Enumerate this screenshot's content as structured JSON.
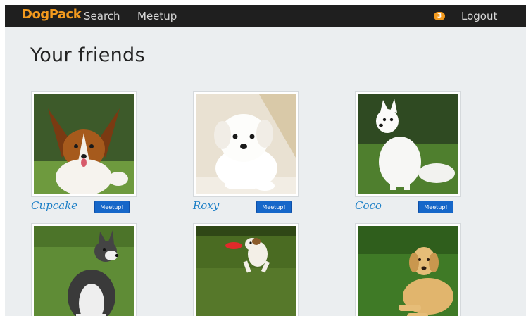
{
  "nav": {
    "brand": "DogPack",
    "search_label": "Search",
    "meetup_label": "Meetup",
    "notification_count": "3",
    "logout_label": "Logout"
  },
  "page": {
    "title": "Your friends"
  },
  "friends": [
    {
      "name": "Cupcake",
      "button_label": "Meetup!"
    },
    {
      "name": "Roxy",
      "button_label": "Meetup!"
    },
    {
      "name": "Coco",
      "button_label": "Meetup!"
    },
    {
      "name": "",
      "button_label": ""
    },
    {
      "name": "",
      "button_label": ""
    },
    {
      "name": "",
      "button_label": ""
    }
  ],
  "colors": {
    "brand": "#f39a1e",
    "navbar": "#1f1f1f",
    "page_background": "#ebeef0",
    "link_blue": "#1a7ec6",
    "button_blue": "#1667c9"
  }
}
